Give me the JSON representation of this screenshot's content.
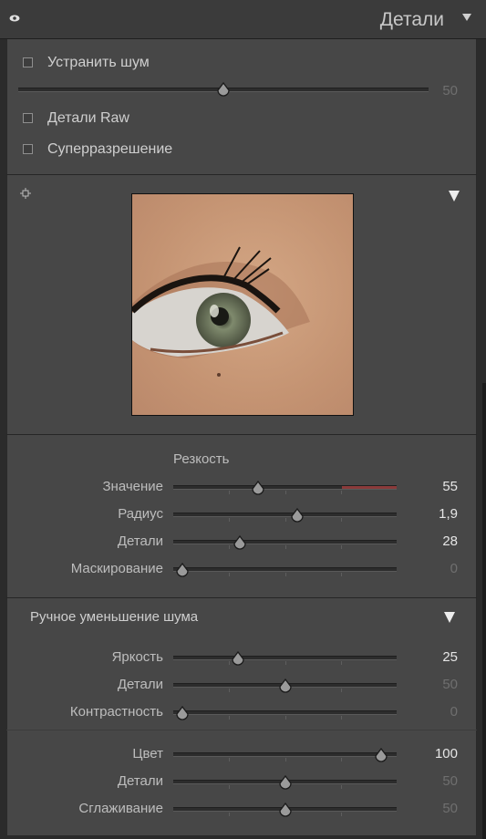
{
  "header": {
    "title": "Детали"
  },
  "noise": {
    "remove_label": "Устранить шум",
    "slider_value": "50",
    "slider_level": 50,
    "raw_details_label": "Детали Raw",
    "super_resolution_label": "Суперразрешение"
  },
  "sharpening": {
    "heading": "Резкость",
    "sliders": [
      {
        "label": "Значение",
        "value": "55",
        "level": 37,
        "active": true
      },
      {
        "label": "Радиус",
        "value": "1,9",
        "level": 56,
        "active": true
      },
      {
        "label": "Детали",
        "value": "28",
        "level": 28,
        "active": true
      },
      {
        "label": "Маскирование",
        "value": "0",
        "level": 0,
        "active": false
      }
    ]
  },
  "manual_noise": {
    "heading": "Ручное уменьшение шума",
    "luminance": [
      {
        "label": "Яркость",
        "value": "25",
        "level": 27,
        "active": true
      },
      {
        "label": "Детали",
        "value": "50",
        "level": 50,
        "active": false
      },
      {
        "label": "Контрастность",
        "value": "0",
        "level": 0,
        "active": false
      }
    ],
    "color": [
      {
        "label": "Цвет",
        "value": "100",
        "level": 97,
        "active": true
      },
      {
        "label": "Детали",
        "value": "50",
        "level": 50,
        "active": false
      },
      {
        "label": "Сглаживание",
        "value": "50",
        "level": 50,
        "active": false
      }
    ]
  },
  "colors": {
    "panel": "#474747",
    "text": "#cfcfcf",
    "accent_red": "#8a3a3a"
  }
}
